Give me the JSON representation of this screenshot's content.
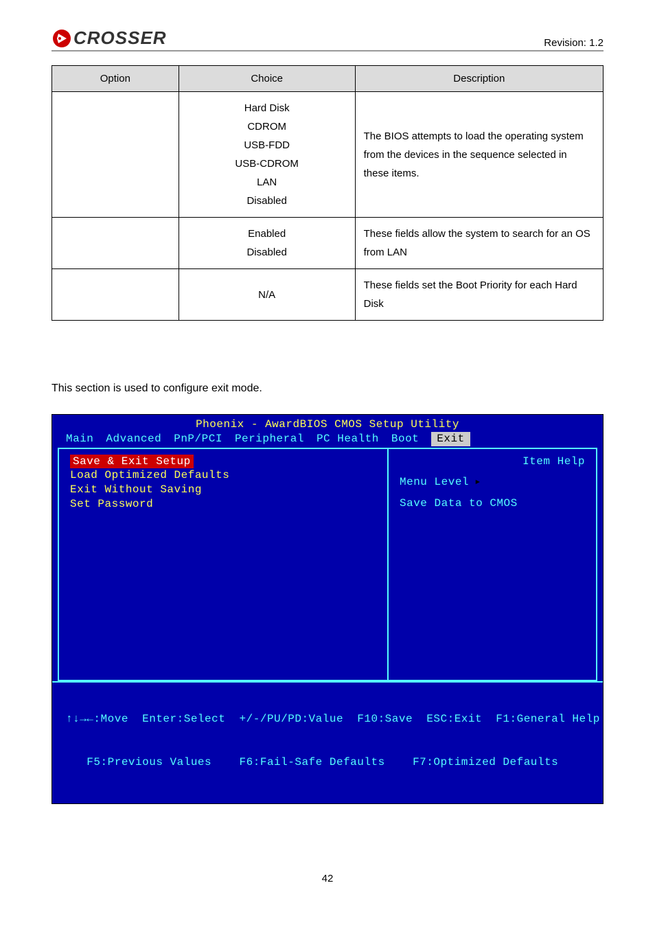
{
  "header": {
    "logo_text": "CROSSER",
    "revision": "Revision: 1.2"
  },
  "table": {
    "headers": {
      "option": "Option",
      "choice": "Choice",
      "description": "Description"
    },
    "rows": [
      {
        "choice": "Hard Disk\nCDROM\nUSB-FDD\nUSB-CDROM\nLAN\nDisabled",
        "description": "The BIOS attempts to load the operating system from the devices in the sequence selected in these items."
      },
      {
        "choice": "Enabled\nDisabled",
        "description": "These fields allow the system to search for an OS from LAN"
      },
      {
        "choice": "N/A",
        "description": "These fields set the Boot Priority for each Hard Disk"
      }
    ]
  },
  "section_text": "This section is used to configure exit mode.",
  "bios": {
    "title": "Phoenix - AwardBIOS CMOS Setup Utility",
    "menu": [
      "Main",
      "Advanced",
      "PnP/PCI",
      "Peripheral",
      "PC Health",
      "Boot",
      "Exit"
    ],
    "active_menu": "Exit",
    "left_items": [
      "Save & Exit Setup",
      "Load Optimized Defaults",
      "Exit Without Saving",
      "Set Password"
    ],
    "selected_left": "Save & Exit Setup",
    "item_help_title": "Item Help",
    "menu_level": "Menu Level",
    "help_text": "Save Data to CMOS",
    "footer_line1": "↑↓→←:Move  Enter:Select  +/-/PU/PD:Value  F10:Save  ESC:Exit  F1:General Help",
    "footer_line2": "   F5:Previous Values    F6:Fail-Safe Defaults    F7:Optimized Defaults"
  },
  "pagenum": "42"
}
